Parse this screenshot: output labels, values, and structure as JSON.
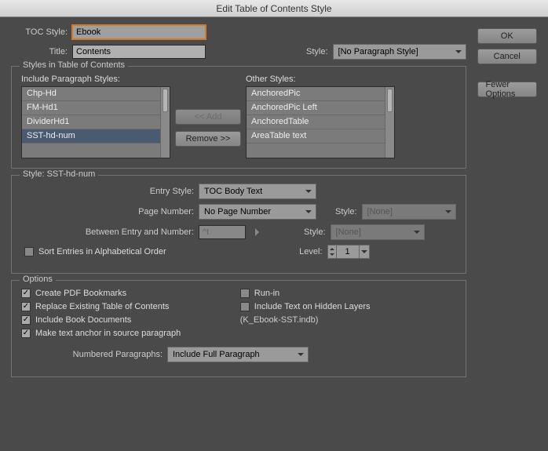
{
  "window": {
    "title": "Edit Table of Contents Style"
  },
  "buttons": {
    "ok": "OK",
    "cancel": "Cancel",
    "fewer": "Fewer Options",
    "add": "<< Add",
    "remove": "Remove >>"
  },
  "top": {
    "toc_style_label": "TOC Style:",
    "toc_style_value": "Ebook",
    "title_label": "Title:",
    "title_value": "Contents",
    "style_label": "Style:",
    "style_value": "[No Paragraph Style]"
  },
  "styles_section": {
    "legend": "Styles in Table of Contents",
    "include_label": "Include Paragraph Styles:",
    "other_label": "Other Styles:",
    "include_items": [
      "Chp-Hd",
      "FM-Hd1",
      "DividerHd1",
      "SST-hd-num"
    ],
    "include_selected": "SST-hd-num",
    "other_items": [
      "AnchoredPic",
      "AnchoredPic Left",
      "AnchoredTable",
      "AreaTable text"
    ]
  },
  "detail": {
    "legend": "Style: SST-hd-num",
    "entry_style_label": "Entry Style:",
    "entry_style_value": "TOC Body Text",
    "page_number_label": "Page Number:",
    "page_number_value": "No Page Number",
    "pn_style_label": "Style:",
    "pn_style_value": "[None]",
    "between_label": "Between Entry and Number:",
    "between_value": "^t",
    "between_style_label": "Style:",
    "between_style_value": "[None]",
    "sort_label": "Sort Entries in Alphabetical Order",
    "level_label": "Level:",
    "level_value": "1"
  },
  "options": {
    "legend": "Options",
    "create_bookmarks": "Create PDF Bookmarks",
    "replace_existing": "Replace Existing Table of Contents",
    "include_book": "Include Book Documents",
    "book_note": "(K_Ebook-SST.indb)",
    "make_anchor": "Make text anchor in source paragraph",
    "runin": "Run-in",
    "hidden_layers": "Include Text on Hidden Layers",
    "numbered_label": "Numbered Paragraphs:",
    "numbered_value": "Include Full Paragraph"
  }
}
